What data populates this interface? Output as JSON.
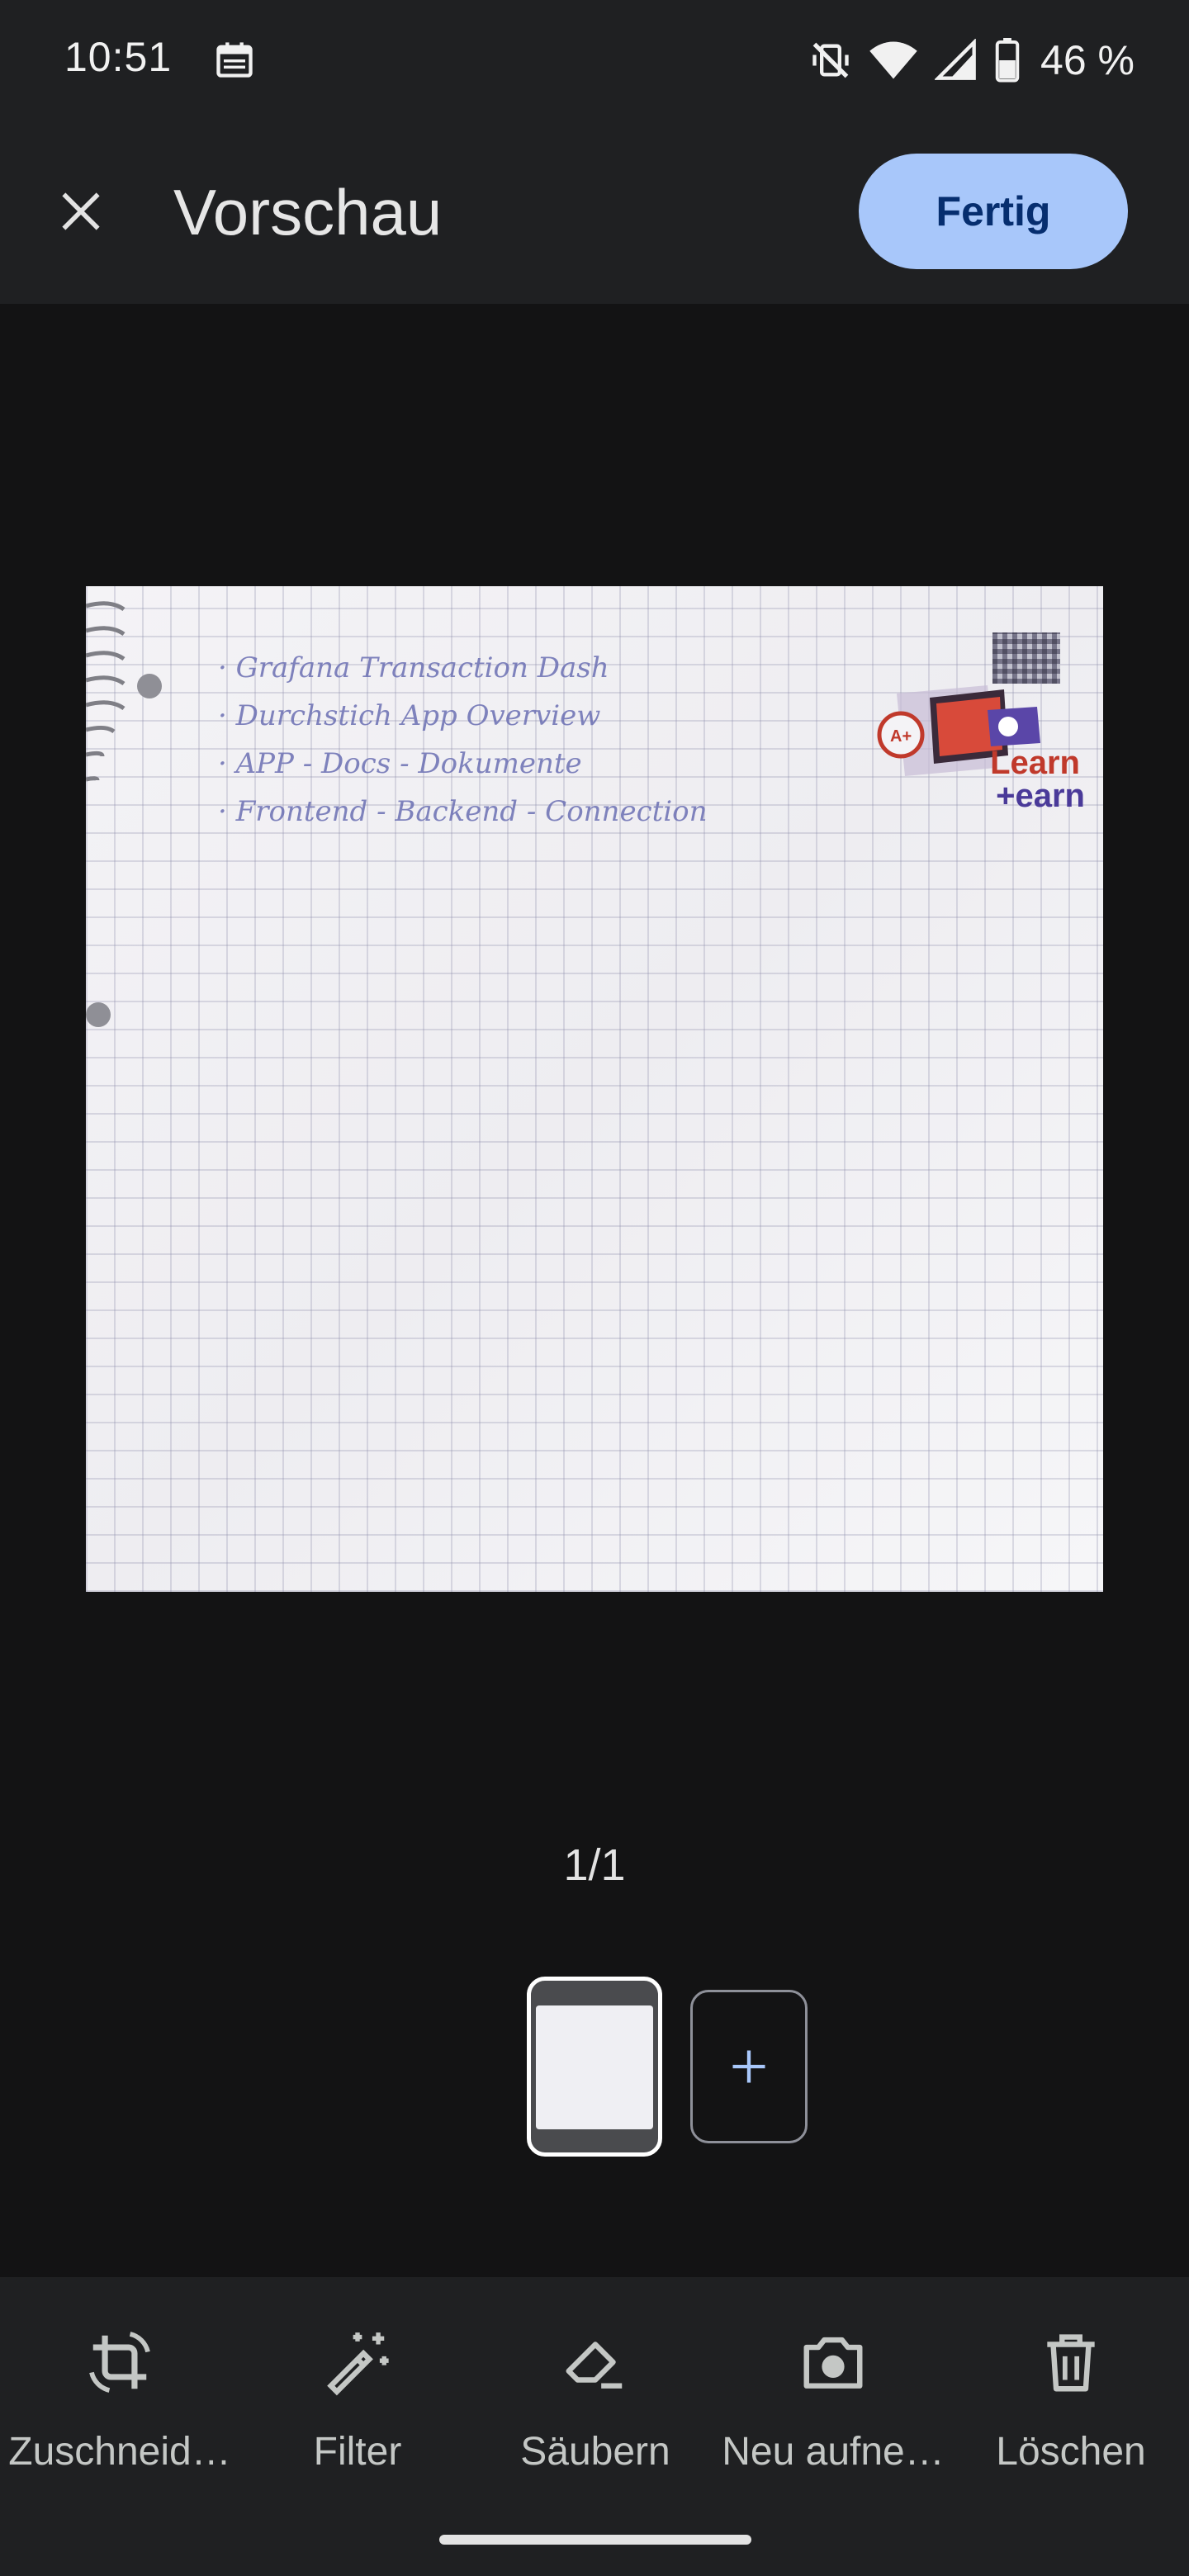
{
  "status_bar": {
    "time": "10:51",
    "battery_percent": "46 %",
    "icons": [
      "calendar-icon",
      "mute-vibrate-icon",
      "wifi-icon",
      "signal-icon",
      "battery-icon"
    ]
  },
  "app_bar": {
    "title": "Vorschau",
    "done_label": "Fertig",
    "close_icon": "close-icon"
  },
  "preview": {
    "handwritten_lines": [
      "Grafana Transaction Dash",
      "Durchstich App Overview",
      "APP - Docs - Dokumente",
      "Frontend - Backend - Connection"
    ],
    "logo_line1": "Learn",
    "logo_line2": "+earn"
  },
  "pager": {
    "text": "1/1"
  },
  "toolbar": {
    "items": [
      {
        "label": "Zuschneid…",
        "icon": "crop-rotate-icon"
      },
      {
        "label": "Filter",
        "icon": "magic-wand-icon"
      },
      {
        "label": "Säubern",
        "icon": "eraser-icon"
      },
      {
        "label": "Neu aufne…",
        "icon": "camera-icon"
      },
      {
        "label": "Löschen",
        "icon": "trash-icon"
      }
    ]
  },
  "colors": {
    "background": "#131314",
    "bar": "#1f2022",
    "primary_button": "#a8c7fa",
    "primary_button_text": "#062e6f"
  }
}
